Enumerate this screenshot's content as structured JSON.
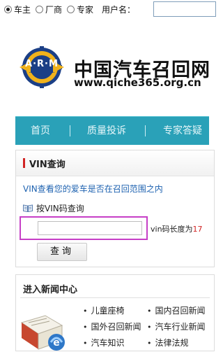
{
  "topbar": {
    "radios": [
      {
        "label": "车主",
        "checked": true
      },
      {
        "label": "厂商",
        "checked": false
      },
      {
        "label": "专家",
        "checked": false
      }
    ],
    "username_label": "用户名："
  },
  "logo": {
    "emblem_text": "A·R·M",
    "title": "中国汽车召回网",
    "url": "www.qiche365.org.cn"
  },
  "nav": {
    "items": [
      "首页",
      "质量投诉",
      "专家答疑"
    ]
  },
  "vin": {
    "title": "VIN查询",
    "description": "VIN查看您的爱车是否在召回范围之内",
    "sub_label": "按VIN码查询",
    "input_value": "",
    "length_note_prefix": "vin码长度为",
    "length_number": "17",
    "query_button": "查询"
  },
  "news": {
    "title": "进入新闻中心",
    "links": [
      "儿童座椅",
      "国内召回新闻",
      "国外召回新闻",
      "汽车行业新闻",
      "汽车知识",
      "法律法规"
    ]
  },
  "colors": {
    "nav_bg": "#2aa1b8",
    "link_blue": "#1e62b0",
    "accent_red": "#d12424",
    "highlight_magenta": "#c63fc6"
  }
}
